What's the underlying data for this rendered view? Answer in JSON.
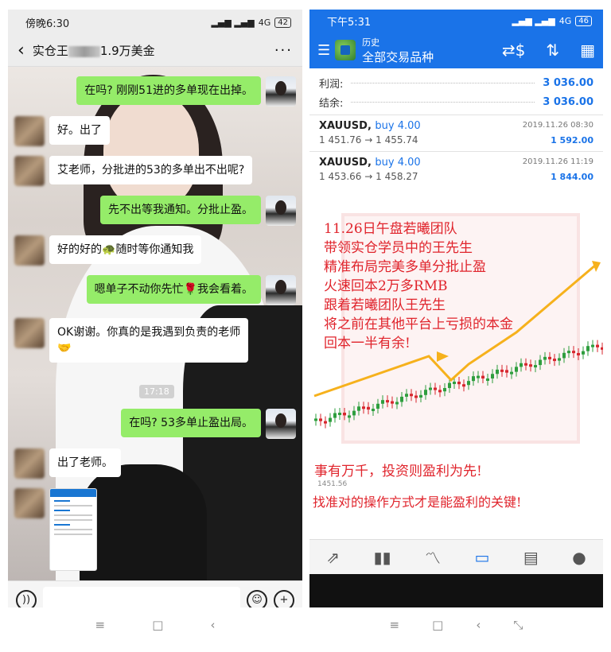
{
  "left": {
    "status": {
      "time": "傍晚6:30",
      "network": "4G",
      "battery": "42"
    },
    "header": {
      "title_prefix": "实仓王",
      "title_suffix": "1.9万美金",
      "more": "···",
      "back": "‹"
    },
    "messages": [
      {
        "from": "me",
        "text": "在吗? 刚刚51进的多单现在出掉。"
      },
      {
        "from": "other",
        "text": "好。出了"
      },
      {
        "from": "other",
        "text": "艾老师，分批进的53的多单出不出呢?"
      },
      {
        "from": "me",
        "text": "先不出等我通知。分批止盈。"
      },
      {
        "from": "other",
        "text_before": "好的好的",
        "emoji": "🐢",
        "text_after": "随时等你通知我"
      },
      {
        "from": "me",
        "text_before": "嗯单子不动你先忙",
        "emoji": "🌹",
        "text_after": "我会看着。"
      },
      {
        "from": "other",
        "text": "OK谢谢。你真的是我遇到负责的老师",
        "emoji": "🤝"
      },
      {
        "from": "me",
        "text": "在吗? 53多单止盈出局。"
      },
      {
        "from": "other",
        "text": "出了老师。"
      }
    ],
    "timestamp": "17:18",
    "input": {
      "voice_icon": "voice-icon",
      "emoji_icon": "emoji-icon",
      "plus_icon": "plus-icon"
    },
    "sysnav": [
      "≡",
      "□",
      "‹"
    ]
  },
  "right": {
    "status": {
      "time": "下午5:31",
      "network": "4G",
      "battery": "46"
    },
    "appbar": {
      "subtitle": "历史",
      "title": "全部交易品种"
    },
    "summary": [
      {
        "label": "利润:",
        "value": "3 036.00"
      },
      {
        "label": "结余:",
        "value": "3 036.00"
      }
    ],
    "trades": [
      {
        "symbol": "XAUUSD,",
        "side": "buy 4.00",
        "prices": "1 451.76 → 1 455.74",
        "date": "2019.11.26 08:30",
        "profit": "1 592.00"
      },
      {
        "symbol": "XAUUSD,",
        "side": "buy 4.00",
        "prices": "1 453.66 → 1 458.27",
        "date": "2019.11.26 11:19",
        "profit": "1 844.00"
      }
    ],
    "overlay_lines": [
      "11.26日午盘若曦团队",
      "带领实仓学员中的王先生",
      "精准布局完美多单分批止盈",
      "火速回本2万多RMB",
      "跟着若曦团队王先生",
      "将之前在其他平台上亏损的本金",
      "回本一半有余!"
    ],
    "price_label": "1451.56",
    "slogan1": "事有万千，投资则盈利为先!",
    "slogan2": "找准对的操作方式才是能盈利的关键!",
    "sysnav": [
      "≡",
      "□",
      "‹",
      "⤡"
    ]
  },
  "colors": {
    "accent": "#1a73e8",
    "wechat_green": "#95ec69",
    "overlay_red": "#e0242c"
  }
}
